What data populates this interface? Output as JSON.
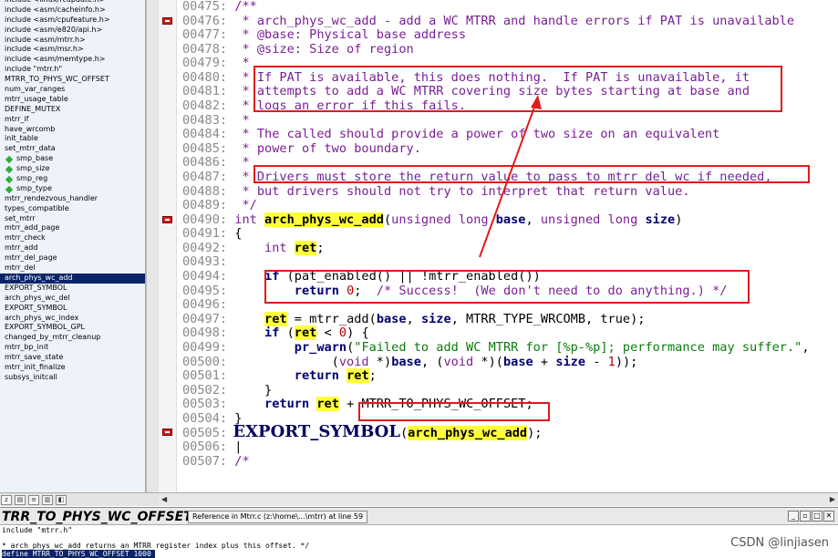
{
  "symbols": [
    {
      "label": "include <linux/rcupdate.h>",
      "child": false
    },
    {
      "label": "include <asm/cacheinfo.h>",
      "child": false
    },
    {
      "label": "include <asm/cpufeature.h>",
      "child": false
    },
    {
      "label": "include <asm/e820/api.h>",
      "child": false
    },
    {
      "label": "include <asm/mtrr.h>",
      "child": false
    },
    {
      "label": "include <asm/msr.h>",
      "child": false
    },
    {
      "label": "include <asm/memtype.h>",
      "child": false
    },
    {
      "label": "include \"mtrr.h\"",
      "child": false
    },
    {
      "label": "MTRR_TO_PHYS_WC_OFFSET",
      "child": false
    },
    {
      "label": "num_var_ranges",
      "child": false
    },
    {
      "label": "mtrr_usage_table",
      "child": false
    },
    {
      "label": "DEFINE_MUTEX",
      "child": false
    },
    {
      "label": "mtrr_if",
      "child": false
    },
    {
      "label": "have_wrcomb",
      "child": false
    },
    {
      "label": "init_table",
      "child": false
    },
    {
      "label": "set_mtrr_data",
      "child": false
    },
    {
      "label": "smp_base",
      "child": true
    },
    {
      "label": "smp_size",
      "child": true
    },
    {
      "label": "smp_reg",
      "child": true
    },
    {
      "label": "smp_type",
      "child": true
    },
    {
      "label": "mtrr_rendezvous_handler",
      "child": false
    },
    {
      "label": "types_compatible",
      "child": false
    },
    {
      "label": "set_mtrr",
      "child": false
    },
    {
      "label": "mtrr_add_page",
      "child": false
    },
    {
      "label": "mtrr_check",
      "child": false
    },
    {
      "label": "mtrr_add",
      "child": false
    },
    {
      "label": "mtrr_del_page",
      "child": false
    },
    {
      "label": "mtrr_del",
      "child": false
    },
    {
      "label": "arch_phys_wc_add",
      "child": false,
      "selected": true
    },
    {
      "label": "EXPORT_SYMBOL",
      "child": false
    },
    {
      "label": "arch_phys_wc_del",
      "child": false
    },
    {
      "label": "EXPORT_SYMBOL",
      "child": false
    },
    {
      "label": "arch_phys_wc_index",
      "child": false
    },
    {
      "label": "EXPORT_SYMBOL_GPL",
      "child": false
    },
    {
      "label": "changed_by_mtrr_cleanup",
      "child": false
    },
    {
      "label": "mtrr_bp_init",
      "child": false
    },
    {
      "label": "mtrr_save_state",
      "child": false
    },
    {
      "label": "mtrr_init_finalize",
      "child": false
    },
    {
      "label": "subsys_initcall",
      "child": false
    }
  ],
  "code_lines": [
    {
      "ln": "00475:",
      "seg": [
        {
          "t": " /**",
          "c": "cm"
        }
      ]
    },
    {
      "ln": "00476:",
      "bp": true,
      "seg": [
        {
          "t": "  * arch_phys_wc_add - add a WC MTRR and handle errors if PAT is unavailable",
          "c": "cm"
        }
      ]
    },
    {
      "ln": "00477:",
      "seg": [
        {
          "t": "  * @base: Physical base address",
          "c": "cm"
        }
      ]
    },
    {
      "ln": "00478:",
      "seg": [
        {
          "t": "  * @size: Size of region",
          "c": "cm"
        }
      ]
    },
    {
      "ln": "00479:",
      "seg": [
        {
          "t": "  *",
          "c": "cm"
        }
      ]
    },
    {
      "ln": "00480:",
      "seg": [
        {
          "t": "  * If PAT is available, this does nothing.  If PAT is unavailable, it",
          "c": "cm"
        }
      ]
    },
    {
      "ln": "00481:",
      "seg": [
        {
          "t": "  * attempts to add a WC MTRR covering size bytes starting at base and",
          "c": "cm"
        }
      ]
    },
    {
      "ln": "00482:",
      "seg": [
        {
          "t": "  * logs an error if this fails.",
          "c": "cm"
        }
      ]
    },
    {
      "ln": "00483:",
      "seg": [
        {
          "t": "  *",
          "c": "cm"
        }
      ]
    },
    {
      "ln": "00484:",
      "seg": [
        {
          "t": "  * The called should provide a power of two size on an equivalent",
          "c": "cm"
        }
      ]
    },
    {
      "ln": "00485:",
      "seg": [
        {
          "t": "  * power of two boundary.",
          "c": "cm"
        }
      ]
    },
    {
      "ln": "00486:",
      "seg": [
        {
          "t": "  *",
          "c": "cm"
        }
      ]
    },
    {
      "ln": "00487:",
      "seg": [
        {
          "t": "  * Drivers must store the return value to pass to mtrr_del_wc if needed,",
          "c": "cm"
        }
      ]
    },
    {
      "ln": "00488:",
      "seg": [
        {
          "t": "  * but drivers should not try to interpret that return value.",
          "c": "cm"
        }
      ]
    },
    {
      "ln": "00489:",
      "seg": [
        {
          "t": "  */",
          "c": "cm"
        }
      ]
    },
    {
      "ln": "00490:",
      "bp": true,
      "seg": [
        {
          "t": " int ",
          "c": "ty"
        },
        {
          "t": "arch_phys_wc_add",
          "c": "hl"
        },
        {
          "t": "(",
          "c": ""
        },
        {
          "t": "unsigned long ",
          "c": "ty"
        },
        {
          "t": "base",
          "c": "kw"
        },
        {
          "t": ", ",
          "c": ""
        },
        {
          "t": "unsigned long ",
          "c": "ty"
        },
        {
          "t": "size",
          "c": "kw"
        },
        {
          "t": ")",
          "c": ""
        }
      ]
    },
    {
      "ln": "00491:",
      "seg": [
        {
          "t": " {",
          "c": ""
        }
      ]
    },
    {
      "ln": "00492:",
      "seg": [
        {
          "t": "     int ",
          "c": "ty"
        },
        {
          "t": "ret",
          "c": "hl"
        },
        {
          "t": ";",
          "c": ""
        }
      ]
    },
    {
      "ln": "00493:",
      "seg": []
    },
    {
      "ln": "00494:",
      "seg": [
        {
          "t": "     ",
          "c": ""
        },
        {
          "t": "if",
          "c": "kw"
        },
        {
          "t": " (pat_enabled() || !mtrr_enabled())",
          "c": ""
        }
      ]
    },
    {
      "ln": "00495:",
      "seg": [
        {
          "t": "         ",
          "c": ""
        },
        {
          "t": "return",
          "c": "kw"
        },
        {
          "t": " ",
          "c": ""
        },
        {
          "t": "0",
          "c": "num"
        },
        {
          "t": ";  ",
          "c": ""
        },
        {
          "t": "/* Success!  (We don't need to do anything.) */",
          "c": "cm"
        }
      ]
    },
    {
      "ln": "00496:",
      "seg": []
    },
    {
      "ln": "00497:",
      "seg": [
        {
          "t": "     ",
          "c": ""
        },
        {
          "t": "ret",
          "c": "hl"
        },
        {
          "t": " = mtrr_add(",
          "c": ""
        },
        {
          "t": "base",
          "c": "kw"
        },
        {
          "t": ", ",
          "c": ""
        },
        {
          "t": "size",
          "c": "kw"
        },
        {
          "t": ", MTRR_TYPE_WRCOMB, true);",
          "c": ""
        }
      ]
    },
    {
      "ln": "00498:",
      "seg": [
        {
          "t": "     ",
          "c": ""
        },
        {
          "t": "if",
          "c": "kw"
        },
        {
          "t": " (",
          "c": ""
        },
        {
          "t": "ret",
          "c": "hl"
        },
        {
          "t": " < ",
          "c": ""
        },
        {
          "t": "0",
          "c": "num"
        },
        {
          "t": ") {",
          "c": ""
        }
      ]
    },
    {
      "ln": "00499:",
      "seg": [
        {
          "t": "         ",
          "c": ""
        },
        {
          "t": "pr_warn",
          "c": "kw"
        },
        {
          "t": "(",
          "c": ""
        },
        {
          "t": "\"Failed to add WC MTRR for [%p-%p]; performance may suffer.\"",
          "c": "st"
        },
        {
          "t": ",",
          "c": ""
        }
      ]
    },
    {
      "ln": "00500:",
      "seg": [
        {
          "t": "              (",
          "c": ""
        },
        {
          "t": "void",
          "c": "ty"
        },
        {
          "t": " *)",
          "c": ""
        },
        {
          "t": "base",
          "c": "kw"
        },
        {
          "t": ", (",
          "c": ""
        },
        {
          "t": "void",
          "c": "ty"
        },
        {
          "t": " *)(",
          "c": ""
        },
        {
          "t": "base",
          "c": "kw"
        },
        {
          "t": " + ",
          "c": ""
        },
        {
          "t": "size",
          "c": "kw"
        },
        {
          "t": " - ",
          "c": ""
        },
        {
          "t": "1",
          "c": "num"
        },
        {
          "t": "));",
          "c": ""
        }
      ]
    },
    {
      "ln": "00501:",
      "seg": [
        {
          "t": "         ",
          "c": ""
        },
        {
          "t": "return",
          "c": "kw"
        },
        {
          "t": " ",
          "c": ""
        },
        {
          "t": "ret",
          "c": "hl"
        },
        {
          "t": ";",
          "c": ""
        }
      ]
    },
    {
      "ln": "00502:",
      "seg": [
        {
          "t": "     }",
          "c": ""
        }
      ]
    },
    {
      "ln": "00503:",
      "seg": [
        {
          "t": "     ",
          "c": ""
        },
        {
          "t": "return",
          "c": "kw"
        },
        {
          "t": " ",
          "c": ""
        },
        {
          "t": "ret",
          "c": "hl"
        },
        {
          "t": " + MTRR_TO_PHYS_WC_OFFSET;",
          "c": ""
        }
      ]
    },
    {
      "ln": "00504:",
      "seg": [
        {
          "t": " }",
          "c": ""
        }
      ]
    },
    {
      "ln": "00505:",
      "bp": true,
      "seg": [
        {
          "t": " EXPORT_SYMBOL",
          "c": "big"
        },
        {
          "t": "(",
          "c": ""
        },
        {
          "t": "arch_phys_wc_add",
          "c": "hl"
        },
        {
          "t": ");",
          "c": ""
        }
      ]
    },
    {
      "ln": "00506:",
      "seg": [
        {
          "t": " |",
          "c": ""
        }
      ]
    },
    {
      "ln": "00507:",
      "seg": [
        {
          "t": " /*",
          "c": "cm"
        }
      ]
    }
  ],
  "context": {
    "symbol": "TRR_TO_PHYS_WC_OFFSET",
    "reference": "Reference in Mtrr.c (z:\\home\\...\\mtrr) at line 59",
    "lines": [
      {
        "t": "include \"mtrr.h\"",
        "sel": false
      },
      {
        "t": "",
        "sel": false
      },
      {
        "t": "* arch_phys_wc_add returns an MTRR register index plus this offset. */",
        "sel": false
      },
      {
        "t": "define MTRR_TO_PHYS_WC_OFFSET 1000",
        "sel": true
      }
    ]
  },
  "watermark": "CSDN @linjiasen"
}
